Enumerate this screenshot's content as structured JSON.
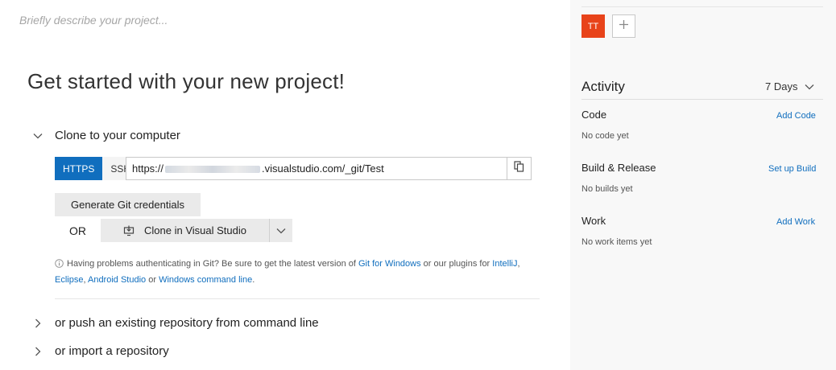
{
  "project": {
    "description_placeholder": "Briefly describe your project...",
    "title": "Get started with your new project!"
  },
  "clone": {
    "section_label": "Clone to your computer",
    "protocols": [
      "HTTPS",
      "SSH"
    ],
    "url_prefix": "https://",
    "url_suffix": ".visualstudio.com/_git/Test",
    "generate_credentials_label": "Generate Git credentials",
    "or_label": "OR",
    "clone_in_vs_label": "Clone in Visual Studio",
    "help": {
      "text1": "Having problems authenticating in Git? Be sure to get the latest version of ",
      "link_git_windows": "Git for Windows",
      "text2": " or our plugins for ",
      "link_intellij": "IntelliJ",
      "text3": ", ",
      "link_eclipse": "Eclipse",
      "text4": ", ",
      "link_android": "Android Studio",
      "text5": " or ",
      "link_cmdline": "Windows command line",
      "text6": "."
    }
  },
  "push": {
    "section_label": "or push an existing repository from command line"
  },
  "import": {
    "section_label": "or import a repository"
  },
  "members": {
    "avatar_initials": "TT",
    "avatar_color": "#e8431a"
  },
  "activity": {
    "title": "Activity",
    "range": "7 Days",
    "code": {
      "label": "Code",
      "link": "Add Code",
      "status": "No code yet"
    },
    "build": {
      "label": "Build & Release",
      "link": "Set up Build",
      "status": "No builds yet"
    },
    "work": {
      "label": "Work",
      "link": "Add Work",
      "status": "No work items yet"
    }
  },
  "colors": {
    "accent": "#106ebe",
    "right_panel_bg": "#f8f8f8"
  },
  "icons": {
    "collapse": "chevron-down-icon",
    "expand": "chevron-right-icon",
    "copy": "copy-icon",
    "clone_vs": "clone-vs-icon",
    "info": "info-icon",
    "add": "plus-icon"
  }
}
